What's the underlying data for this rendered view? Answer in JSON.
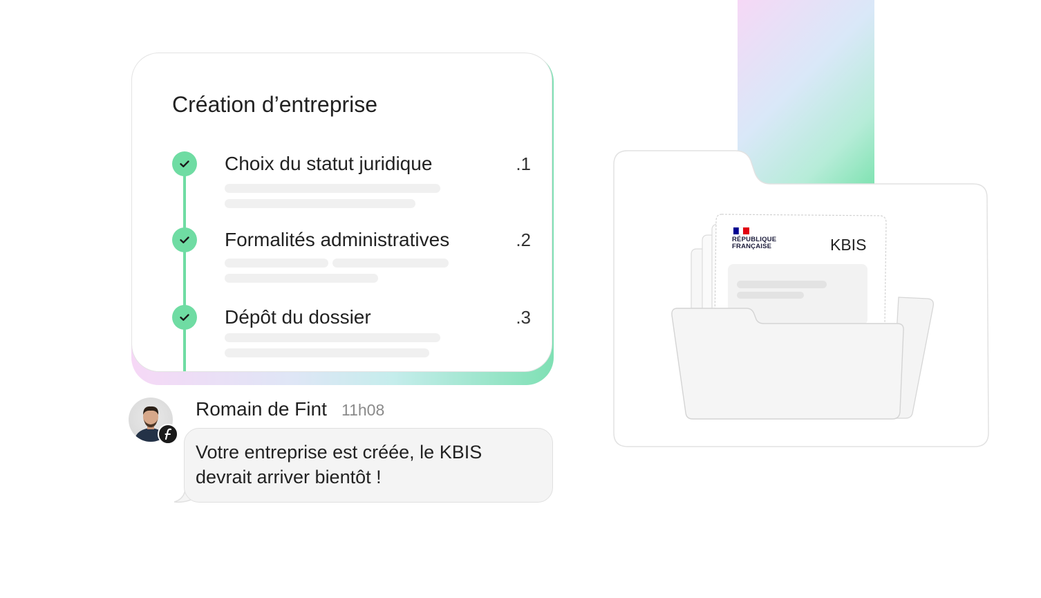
{
  "steps_card": {
    "title": "Création d’entreprise",
    "steps": [
      {
        "label": "Choix du statut juridique",
        "number": ".1",
        "done": true
      },
      {
        "label": "Formalités administratives",
        "number": ".2",
        "done": true
      },
      {
        "label": "Dépôt du dossier",
        "number": ".3",
        "done": true
      }
    ]
  },
  "chat": {
    "sender": "Romain de Fint",
    "time": "11h08",
    "message": "Votre entreprise est créée, le KBIS devrait arriver bientôt !"
  },
  "document": {
    "brand_line1": "RÉPUBLIQUE",
    "brand_line2": "FRANÇAISE",
    "title": "KBIS"
  },
  "colors": {
    "accent_green": "#6fdca3",
    "gradient_pink": "#f6d8f6",
    "gradient_blue": "#d9e8f8",
    "gradient_green": "#6fe0a6",
    "flag_blue": "#000091",
    "flag_red": "#e1000f"
  },
  "icons": [
    "check-icon",
    "fint-logo-icon",
    "folder-icon",
    "french-flag-icon"
  ]
}
